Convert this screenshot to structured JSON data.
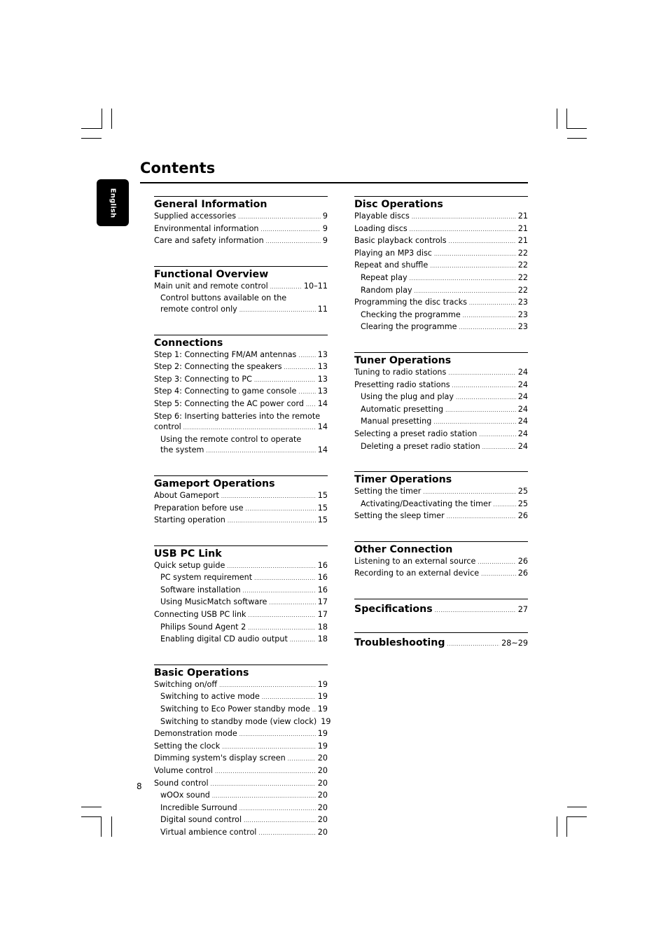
{
  "language_tab": "English",
  "page_title": "Contents",
  "page_number": "8",
  "left_column": [
    {
      "heading": "General Information",
      "entries": [
        {
          "label": "Supplied accessories",
          "page": "9",
          "indent": false
        },
        {
          "label": "Environmental information",
          "page": "9",
          "indent": false
        },
        {
          "label": "Care and safety information",
          "page": "9",
          "indent": false
        }
      ]
    },
    {
      "heading": "Functional Overview",
      "entries": [
        {
          "label": "Main unit and remote control",
          "page": "10–11",
          "indent": false
        },
        {
          "label": "Control buttons available on the",
          "continuation": "remote control only",
          "page": "11",
          "indent": true
        }
      ]
    },
    {
      "heading": "Connections",
      "entries": [
        {
          "label": "Step 1: Connecting FM/AM antennas",
          "page": "13",
          "indent": false
        },
        {
          "label": "Step 2: Connecting the speakers",
          "page": "13",
          "indent": false
        },
        {
          "label": "Step 3: Connecting to PC",
          "page": "13",
          "indent": false
        },
        {
          "label": "Step 4: Connecting to game console",
          "page": "13",
          "indent": false
        },
        {
          "label": "Step 5: Connecting the AC power cord",
          "page": "14",
          "indent": false
        },
        {
          "label": "Step 6: Inserting batteries into the remote",
          "continuation": "control",
          "page": "14",
          "indent": false
        },
        {
          "label": "Using the remote control to operate",
          "continuation": "the system",
          "page": "14",
          "indent": true
        }
      ]
    },
    {
      "heading": "Gameport Operations",
      "entries": [
        {
          "label": "About Gameport",
          "page": "15",
          "indent": false
        },
        {
          "label": "Preparation before use",
          "page": "15",
          "indent": false
        },
        {
          "label": "Starting operation",
          "page": "15",
          "indent": false
        }
      ]
    },
    {
      "heading": "USB PC Link",
      "entries": [
        {
          "label": "Quick setup guide",
          "page": "16",
          "indent": false
        },
        {
          "label": "PC system requirement",
          "page": "16",
          "indent": true
        },
        {
          "label": "Software installation",
          "page": "16",
          "indent": true
        },
        {
          "label": "Using MusicMatch software",
          "page": "17",
          "indent": true
        },
        {
          "label": "Connecting USB PC link",
          "page": "17",
          "indent": false
        },
        {
          "label": "Philips Sound Agent 2",
          "page": "18",
          "indent": true
        },
        {
          "label": "Enabling digital CD audio output",
          "page": "18",
          "indent": true
        }
      ]
    },
    {
      "heading": "Basic Operations",
      "entries": [
        {
          "label": "Switching on/off",
          "page": "19",
          "indent": false
        },
        {
          "label": "Switching to active mode",
          "page": "19",
          "indent": true
        },
        {
          "label": "Switching to Eco Power standby mode",
          "page": "19",
          "indent": true
        },
        {
          "label": "Switching to standby mode (view clock)",
          "page": "19",
          "indent": true
        },
        {
          "label": "Demonstration mode",
          "page": "19",
          "indent": false
        },
        {
          "label": "Setting the clock",
          "page": "19",
          "indent": false
        },
        {
          "label": "Dimming system's display screen",
          "page": "20",
          "indent": false
        },
        {
          "label": "Volume control",
          "page": "20",
          "indent": false
        },
        {
          "label": "Sound control",
          "page": "20",
          "indent": false
        },
        {
          "label": "wOOx sound",
          "page": "20",
          "indent": true
        },
        {
          "label": "Incredible Surround",
          "page": "20",
          "indent": true
        },
        {
          "label": "Digital sound control",
          "page": "20",
          "indent": true
        },
        {
          "label": "Virtual ambience control",
          "page": "20",
          "indent": true
        }
      ]
    }
  ],
  "right_column": [
    {
      "heading": "Disc Operations",
      "entries": [
        {
          "label": "Playable discs",
          "page": "21",
          "indent": false
        },
        {
          "label": "Loading discs",
          "page": "21",
          "indent": false
        },
        {
          "label": "Basic playback controls",
          "page": "21",
          "indent": false
        },
        {
          "label": "Playing an MP3 disc",
          "page": "22",
          "indent": false
        },
        {
          "label": "Repeat and shuffle",
          "page": "22",
          "indent": false
        },
        {
          "label": "Repeat play",
          "page": "22",
          "indent": true
        },
        {
          "label": "Random play",
          "page": "22",
          "indent": true
        },
        {
          "label": "Programming the disc tracks",
          "page": "23",
          "indent": false
        },
        {
          "label": "Checking the programme",
          "page": "23",
          "indent": true
        },
        {
          "label": "Clearing the programme",
          "page": "23",
          "indent": true
        }
      ]
    },
    {
      "heading": "Tuner Operations",
      "entries": [
        {
          "label": "Tuning to radio stations",
          "page": "24",
          "indent": false
        },
        {
          "label": "Presetting radio stations",
          "page": "24",
          "indent": false
        },
        {
          "label": "Using the plug and play",
          "page": "24",
          "indent": true
        },
        {
          "label": "Automatic presetting",
          "page": "24",
          "indent": true
        },
        {
          "label": "Manual presetting",
          "page": "24",
          "indent": true
        },
        {
          "label": "Selecting a preset radio station",
          "page": "24",
          "indent": false
        },
        {
          "label": "Deleting a preset radio station",
          "page": "24",
          "indent": true
        }
      ]
    },
    {
      "heading": "Timer Operations",
      "entries": [
        {
          "label": "Setting the timer",
          "page": "25",
          "indent": false
        },
        {
          "label": "Activating/Deactivating the timer",
          "page": "25",
          "indent": true
        },
        {
          "label": "Setting the sleep timer",
          "page": "26",
          "indent": false
        }
      ]
    },
    {
      "heading": "Other Connection",
      "entries": [
        {
          "label": "Listening to an external source",
          "page": "26",
          "indent": false
        },
        {
          "label": "Recording to an external device",
          "page": "26",
          "indent": false
        }
      ]
    }
  ],
  "single_line_sections": [
    {
      "heading": "Specifications",
      "page": "27"
    },
    {
      "heading": "Troubleshooting",
      "page": "28~29"
    }
  ]
}
